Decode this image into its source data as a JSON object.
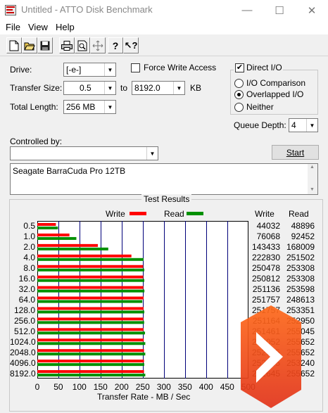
{
  "window": {
    "title": "Untitled - ATTO Disk Benchmark",
    "minimize_glyph": "—",
    "maximize_glyph": "☐",
    "close_glyph": "✕"
  },
  "menu": [
    "File",
    "View",
    "Help"
  ],
  "toolbar": {
    "icons": [
      "new-file-icon",
      "open-folder-icon",
      "save-icon",
      "print-icon",
      "print-preview-icon",
      "move-icon",
      "help-icon",
      "context-help-icon"
    ],
    "help_glyph": "?",
    "context_help_glyph": "?"
  },
  "settings": {
    "drive_label": "Drive:",
    "drive_value": "[-e-]",
    "force_write_label": "Force Write Access",
    "force_write_checked": false,
    "direct_io_label": "Direct I/O",
    "direct_io_checked": true,
    "direct_io_mark": "✔",
    "transfer_size_label": "Transfer Size:",
    "transfer_size_from": "0.5",
    "to_label": "to",
    "transfer_size_to": "8192.0",
    "kb_label": "KB",
    "total_length_label": "Total Length:",
    "total_length_value": "256 MB",
    "io_modes": [
      "I/O Comparison",
      "Overlapped I/O",
      "Neither"
    ],
    "io_mode_selected": "Overlapped I/O",
    "queue_depth_label": "Queue Depth:",
    "queue_depth_value": "4",
    "controlled_by_label": "Controlled by:",
    "controlled_by_value": "",
    "start_label": "Start",
    "description": "Seagate BarraCuda Pro 12TB"
  },
  "chart_data": {
    "type": "bar",
    "title": "Test Results",
    "xlabel": "Transfer Rate - MB / Sec",
    "xlim": [
      0,
      500
    ],
    "x_ticks": [
      "0",
      "50",
      "100",
      "150",
      "200",
      "250",
      "300",
      "350",
      "400",
      "450",
      "500"
    ],
    "grid": true,
    "legend": [
      {
        "name": "Write",
        "color": "#ff0000"
      },
      {
        "name": "Read",
        "color": "#009000"
      }
    ],
    "column_headers": {
      "write": "Write",
      "read": "Read"
    },
    "categories": [
      "0.5",
      "1.0",
      "2.0",
      "4.0",
      "8.0",
      "16.0",
      "32.0",
      "64.0",
      "128.0",
      "256.0",
      "512.0",
      "1024.0",
      "2048.0",
      "4096.0",
      "8192.0"
    ],
    "series": [
      {
        "name": "Write",
        "values": [
          44032,
          76068,
          143433,
          222830,
          250478,
          250812,
          251136,
          251757,
          251757,
          251164,
          251461,
          252052,
          252645,
          252645,
          252645
        ]
      },
      {
        "name": "Read",
        "values": [
          48896,
          92452,
          168009,
          251502,
          253308,
          253308,
          253598,
          248613,
          253351,
          252950,
          255045,
          255652,
          255652,
          253240,
          255652
        ]
      }
    ]
  }
}
